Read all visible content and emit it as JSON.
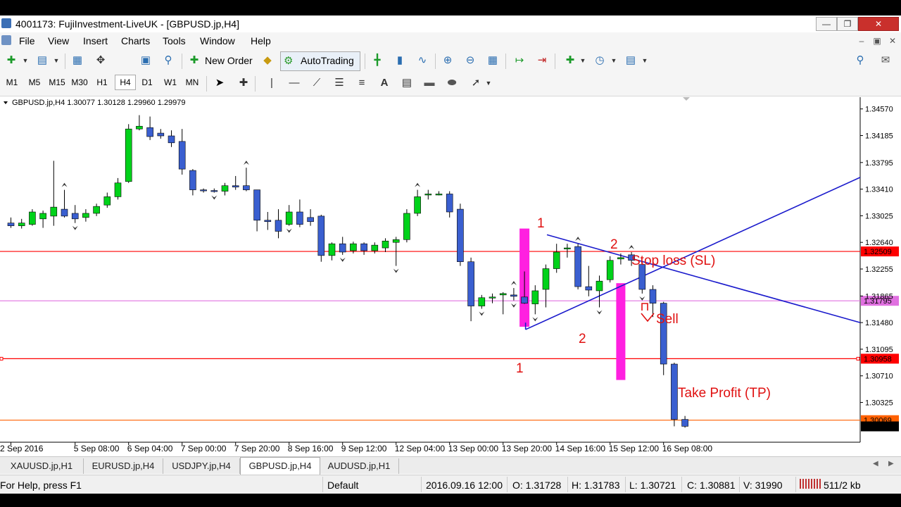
{
  "window": {
    "title": "4001173: FujiInvestment-LiveUK - [GBPUSD.jp,H4]"
  },
  "menu": [
    "File",
    "View",
    "Insert",
    "Charts",
    "Tools",
    "Window",
    "Help"
  ],
  "toolbar": {
    "new_order": "New Order",
    "auto_trading": "AutoTrading"
  },
  "timeframes": [
    "M1",
    "M5",
    "M15",
    "M30",
    "H1",
    "H4",
    "D1",
    "W1",
    "MN"
  ],
  "active_timeframe": "H4",
  "chart": {
    "header": "GBPUSD.jp,H4  1.30077 1.30128 1.29960 1.29979"
  },
  "chart_data": {
    "type": "candlestick",
    "symbol": "GBPUSD.jp",
    "timeframe": "H4",
    "ylim": [
      1.2975,
      1.3474
    ],
    "y_ticks": [
      "1.34570",
      "1.34185",
      "1.33795",
      "1.33410",
      "1.33025",
      "1.32640",
      "1.32255",
      "1.31865",
      "1.31480",
      "1.31095",
      "1.30710",
      "1.30325"
    ],
    "x_ticks": [
      {
        "label": "2 Sep 2016",
        "bar": 0
      },
      {
        "label": "5 Sep 08:00",
        "bar": 6
      },
      {
        "label": "6 Sep 04:00",
        "bar": 11
      },
      {
        "label": "7 Sep 00:00",
        "bar": 16
      },
      {
        "label": "7 Sep 20:00",
        "bar": 21
      },
      {
        "label": "8 Sep 16:00",
        "bar": 26
      },
      {
        "label": "9 Sep 12:00",
        "bar": 31
      },
      {
        "label": "12 Sep 04:00",
        "bar": 36
      },
      {
        "label": "13 Sep 00:00",
        "bar": 41
      },
      {
        "label": "13 Sep 20:00",
        "bar": 46
      },
      {
        "label": "14 Sep 16:00",
        "bar": 51
      },
      {
        "label": "15 Sep 12:00",
        "bar": 56
      },
      {
        "label": "16 Sep 08:00",
        "bar": 61
      }
    ],
    "candles": [
      {
        "o": 1.3292,
        "h": 1.33,
        "l": 1.3285,
        "c": 1.3288
      },
      {
        "o": 1.3288,
        "h": 1.3298,
        "l": 1.3284,
        "c": 1.3292
      },
      {
        "o": 1.329,
        "h": 1.3312,
        "l": 1.3288,
        "c": 1.3308
      },
      {
        "o": 1.3298,
        "h": 1.331,
        "l": 1.3285,
        "c": 1.3306
      },
      {
        "o": 1.3302,
        "h": 1.3382,
        "l": 1.3288,
        "c": 1.3315
      },
      {
        "o": 1.3312,
        "h": 1.334,
        "l": 1.33,
        "c": 1.3302
      },
      {
        "o": 1.3306,
        "h": 1.3318,
        "l": 1.3292,
        "c": 1.3298
      },
      {
        "o": 1.33,
        "h": 1.3312,
        "l": 1.3294,
        "c": 1.3306
      },
      {
        "o": 1.3306,
        "h": 1.332,
        "l": 1.3302,
        "c": 1.3316
      },
      {
        "o": 1.3318,
        "h": 1.3336,
        "l": 1.3314,
        "c": 1.333
      },
      {
        "o": 1.333,
        "h": 1.3357,
        "l": 1.3326,
        "c": 1.335
      },
      {
        "o": 1.3352,
        "h": 1.3435,
        "l": 1.335,
        "c": 1.3428
      },
      {
        "o": 1.3428,
        "h": 1.3448,
        "l": 1.3426,
        "c": 1.3432
      },
      {
        "o": 1.343,
        "h": 1.3446,
        "l": 1.3412,
        "c": 1.3417
      },
      {
        "o": 1.3422,
        "h": 1.3428,
        "l": 1.3414,
        "c": 1.3418
      },
      {
        "o": 1.3418,
        "h": 1.3426,
        "l": 1.3402,
        "c": 1.3408
      },
      {
        "o": 1.341,
        "h": 1.3428,
        "l": 1.3362,
        "c": 1.337
      },
      {
        "o": 1.3368,
        "h": 1.337,
        "l": 1.3332,
        "c": 1.334
      },
      {
        "o": 1.334,
        "h": 1.3342,
        "l": 1.3336,
        "c": 1.3339
      },
      {
        "o": 1.3339,
        "h": 1.3342,
        "l": 1.3336,
        "c": 1.3338
      },
      {
        "o": 1.3338,
        "h": 1.335,
        "l": 1.3332,
        "c": 1.3346
      },
      {
        "o": 1.3346,
        "h": 1.336,
        "l": 1.334,
        "c": 1.3344
      },
      {
        "o": 1.3346,
        "h": 1.3372,
        "l": 1.3338,
        "c": 1.334
      },
      {
        "o": 1.334,
        "h": 1.334,
        "l": 1.328,
        "c": 1.3296
      },
      {
        "o": 1.3296,
        "h": 1.3308,
        "l": 1.3282,
        "c": 1.3294
      },
      {
        "o": 1.3296,
        "h": 1.3312,
        "l": 1.327,
        "c": 1.328
      },
      {
        "o": 1.329,
        "h": 1.3318,
        "l": 1.3288,
        "c": 1.3308
      },
      {
        "o": 1.3308,
        "h": 1.3326,
        "l": 1.3286,
        "c": 1.329
      },
      {
        "o": 1.33,
        "h": 1.3312,
        "l": 1.3288,
        "c": 1.3294
      },
      {
        "o": 1.3302,
        "h": 1.3304,
        "l": 1.3236,
        "c": 1.3245
      },
      {
        "o": 1.3245,
        "h": 1.3264,
        "l": 1.3238,
        "c": 1.3262
      },
      {
        "o": 1.3262,
        "h": 1.3272,
        "l": 1.3246,
        "c": 1.325
      },
      {
        "o": 1.3252,
        "h": 1.3265,
        "l": 1.3248,
        "c": 1.3262
      },
      {
        "o": 1.3262,
        "h": 1.3264,
        "l": 1.3246,
        "c": 1.3252
      },
      {
        "o": 1.3252,
        "h": 1.3264,
        "l": 1.3248,
        "c": 1.326
      },
      {
        "o": 1.3256,
        "h": 1.327,
        "l": 1.325,
        "c": 1.3266
      },
      {
        "o": 1.3264,
        "h": 1.3272,
        "l": 1.323,
        "c": 1.3268
      },
      {
        "o": 1.3268,
        "h": 1.3312,
        "l": 1.3264,
        "c": 1.3306
      },
      {
        "o": 1.3306,
        "h": 1.334,
        "l": 1.3302,
        "c": 1.333
      },
      {
        "o": 1.3334,
        "h": 1.334,
        "l": 1.3326,
        "c": 1.3334
      },
      {
        "o": 1.3334,
        "h": 1.3338,
        "l": 1.3332,
        "c": 1.3334
      },
      {
        "o": 1.3334,
        "h": 1.3338,
        "l": 1.33,
        "c": 1.3308
      },
      {
        "o": 1.3312,
        "h": 1.332,
        "l": 1.323,
        "c": 1.3236
      },
      {
        "o": 1.3236,
        "h": 1.3242,
        "l": 1.315,
        "c": 1.3172
      },
      {
        "o": 1.3172,
        "h": 1.3188,
        "l": 1.3168,
        "c": 1.3184
      },
      {
        "o": 1.3184,
        "h": 1.319,
        "l": 1.3176,
        "c": 1.3185
      },
      {
        "o": 1.3188,
        "h": 1.3192,
        "l": 1.316,
        "c": 1.319
      },
      {
        "o": 1.3188,
        "h": 1.3198,
        "l": 1.318,
        "c": 1.3186
      },
      {
        "o": 1.3185,
        "h": 1.3222,
        "l": 1.3175,
        "c": 1.3176
      },
      {
        "o": 1.3175,
        "h": 1.3202,
        "l": 1.316,
        "c": 1.3194
      },
      {
        "o": 1.3196,
        "h": 1.3232,
        "l": 1.317,
        "c": 1.3226
      },
      {
        "o": 1.3226,
        "h": 1.3262,
        "l": 1.322,
        "c": 1.325
      },
      {
        "o": 1.3255,
        "h": 1.3262,
        "l": 1.3242,
        "c": 1.3256
      },
      {
        "o": 1.3258,
        "h": 1.3262,
        "l": 1.3196,
        "c": 1.32
      },
      {
        "o": 1.32,
        "h": 1.323,
        "l": 1.3186,
        "c": 1.3195
      },
      {
        "o": 1.3194,
        "h": 1.3216,
        "l": 1.317,
        "c": 1.3208
      },
      {
        "o": 1.321,
        "h": 1.3244,
        "l": 1.3206,
        "c": 1.3238
      },
      {
        "o": 1.324,
        "h": 1.3248,
        "l": 1.3232,
        "c": 1.3242
      },
      {
        "o": 1.3246,
        "h": 1.325,
        "l": 1.323,
        "c": 1.3238
      },
      {
        "o": 1.3232,
        "h": 1.3236,
        "l": 1.319,
        "c": 1.3196
      },
      {
        "o": 1.3196,
        "h": 1.3202,
        "l": 1.3156,
        "c": 1.3176
      },
      {
        "o": 1.3176,
        "h": 1.3178,
        "l": 1.3072,
        "c": 1.3088
      },
      {
        "o": 1.3088,
        "h": 1.309,
        "l": 1.2998,
        "c": 1.3008
      },
      {
        "o": 1.3008,
        "h": 1.3013,
        "l": 1.2996,
        "c": 1.2998
      }
    ],
    "fractals_up": [
      5,
      22,
      38,
      47,
      53,
      58
    ],
    "fractals_down": [
      6,
      19,
      26,
      31,
      36,
      44,
      47,
      49,
      55,
      59
    ],
    "horizontal_lines": [
      {
        "price": 1.32509,
        "label": "1.32509",
        "color": "#ff0000"
      },
      {
        "price": 1.31795,
        "label": "1.31795",
        "color": "#e070e0"
      },
      {
        "price": 1.30958,
        "label": "1.30958",
        "color": "#ff0000"
      },
      {
        "price": 1.30069,
        "label": "1.30069",
        "color": "#ff6000"
      }
    ],
    "current_price": "1.29979",
    "annotations": {
      "stop_loss": "Stop loss (SL)",
      "sell": "Sell",
      "take_profit": "Take Profit (TP)",
      "wave_top_1": "1",
      "wave_top_2": "2",
      "wave_bottom_1": "1",
      "wave_bottom_2": "2"
    },
    "colors": {
      "bull": "#00d21a",
      "bear": "#3a5fd0",
      "highlight": "#ff20e0",
      "trendline": "#1a1acc"
    }
  },
  "tabs": [
    "XAUUSD.jp,H1",
    "EURUSD.jp,H4",
    "USDJPY.jp,H4",
    "GBPUSD.jp,H4",
    "AUDUSD.jp,H1"
  ],
  "active_tab": "GBPUSD.jp,H4",
  "status": {
    "help": "For Help, press F1",
    "profile": "Default",
    "datetime": "2016.09.16 12:00",
    "open": "O: 1.31728",
    "high": "H: 1.31783",
    "low": "L: 1.30721",
    "close": "C: 1.30881",
    "volume": "V: 31990",
    "traffic": "511/2 kb"
  }
}
